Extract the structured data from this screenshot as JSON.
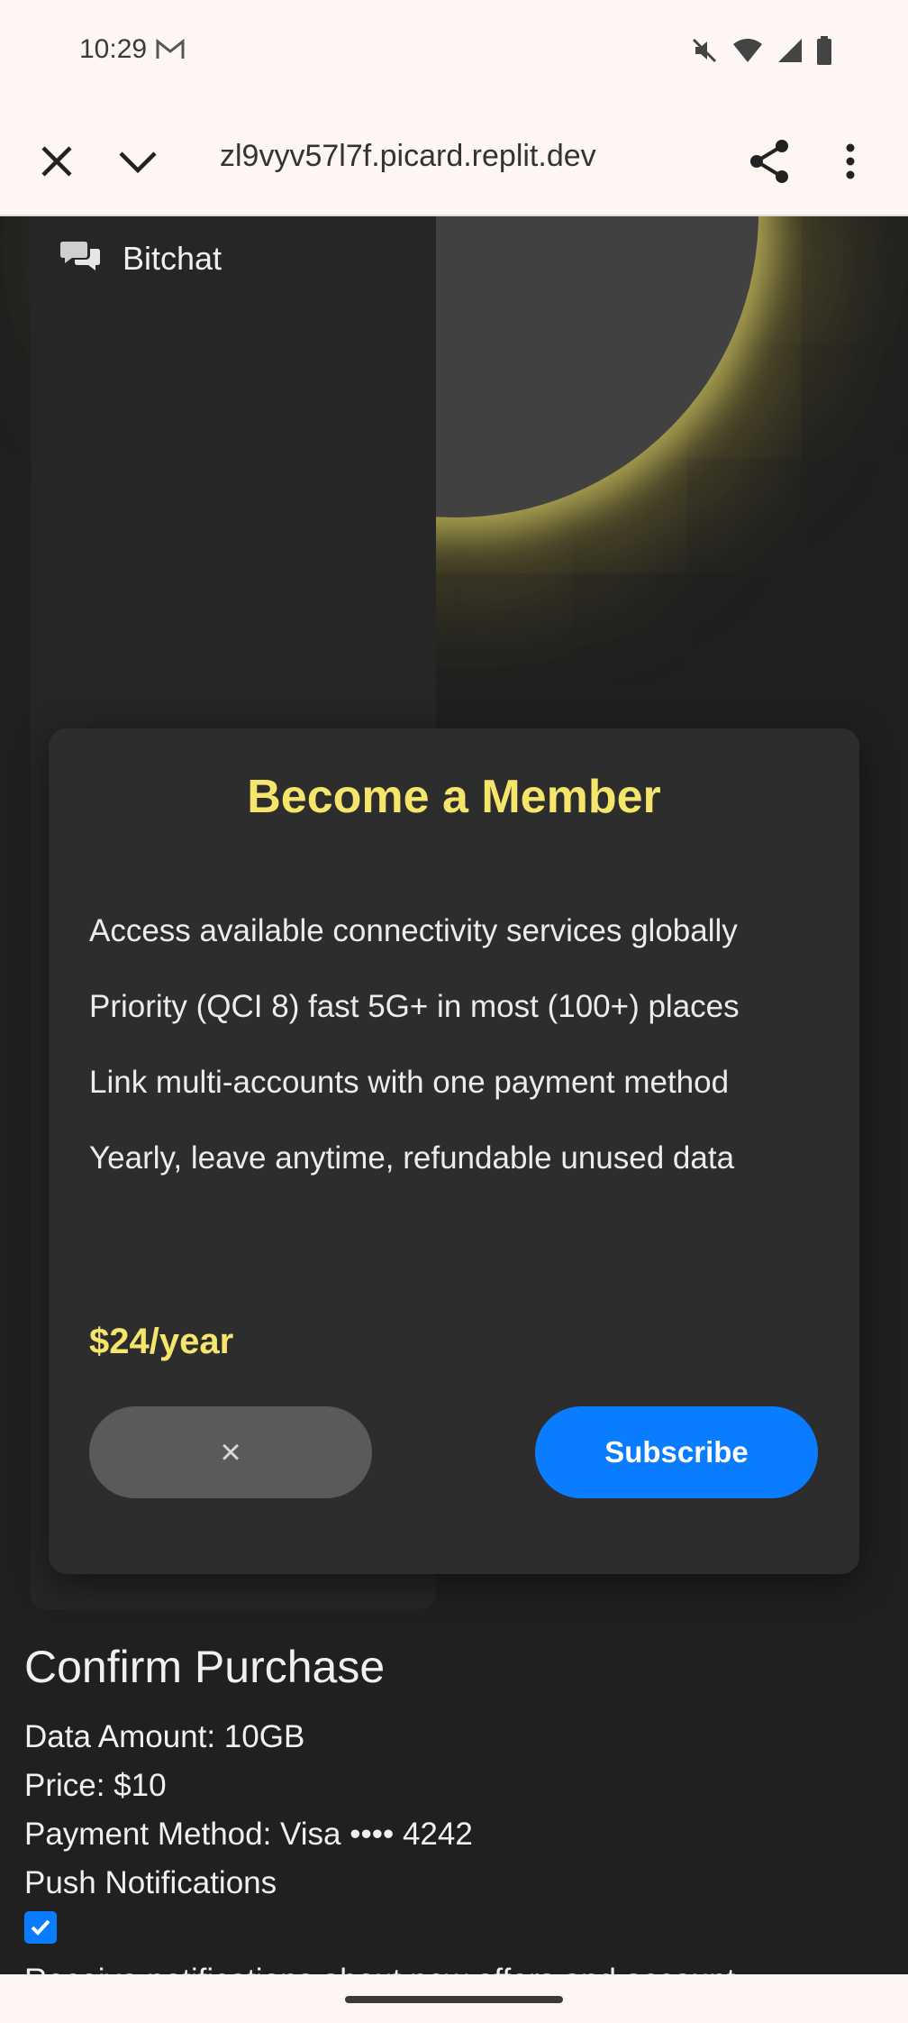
{
  "status_bar": {
    "time": "10:29",
    "icons": [
      "mail-icon",
      "mute-icon",
      "wifi-icon",
      "signal-icon",
      "battery-icon"
    ]
  },
  "browser": {
    "url": "zl9vyv57l7f.picard.replit.dev",
    "icons": [
      "close-icon",
      "chevron-down-icon",
      "share-icon",
      "more-icon"
    ]
  },
  "app": {
    "brand_name": "Bitchat",
    "brand_icon": "chat-bubbles-icon"
  },
  "modal": {
    "title": "Become a Member",
    "features": [
      "Access available connectivity services globally",
      "Priority (QCI 8) fast 5G+ in most (100+) places",
      "Link multi-accounts with one payment method",
      "Yearly, leave anytime, refundable unused data"
    ],
    "price": "$24/year",
    "dismiss_label": "×",
    "subscribe_label": "Subscribe",
    "colors": {
      "accent": "#f5e66b",
      "primary": "#0a7cff"
    }
  },
  "confirm": {
    "title": "Confirm Purchase",
    "data_amount": "Data Amount: 10GB",
    "price": "Price: $10",
    "payment_method": "Payment Method: Visa •••• 4242",
    "push_label": "Push Notifications",
    "push_checked": true,
    "notify_text": "Receive notifications about new offers and account"
  }
}
